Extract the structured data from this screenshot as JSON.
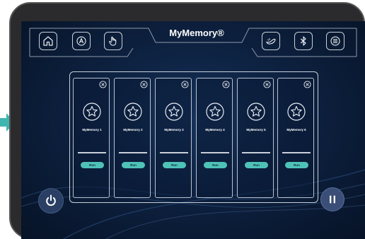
{
  "header": {
    "title": "MyMemory®",
    "left_icons": [
      "home-icon",
      "auto-icon",
      "hand-icon"
    ],
    "right_icons": [
      "foot-massage-icon",
      "bluetooth-icon",
      "menu-icon"
    ]
  },
  "memories": [
    {
      "label": "MyMemory 1",
      "action": "Run"
    },
    {
      "label": "MyMemory 2",
      "action": "Run"
    },
    {
      "label": "MyMemory 3",
      "action": "Run"
    },
    {
      "label": "MyMemory 4",
      "action": "Run"
    },
    {
      "label": "MyMemory 5",
      "action": "Run"
    },
    {
      "label": "MyMemory 6",
      "action": "Run"
    }
  ],
  "controls": {
    "power_icon": "power-icon",
    "pause_icon": "pause-icon"
  },
  "colors": {
    "accent": "#4fc2b8",
    "indicator_arrow": "#3fb6b0",
    "screen_bg": "#0d2140"
  }
}
